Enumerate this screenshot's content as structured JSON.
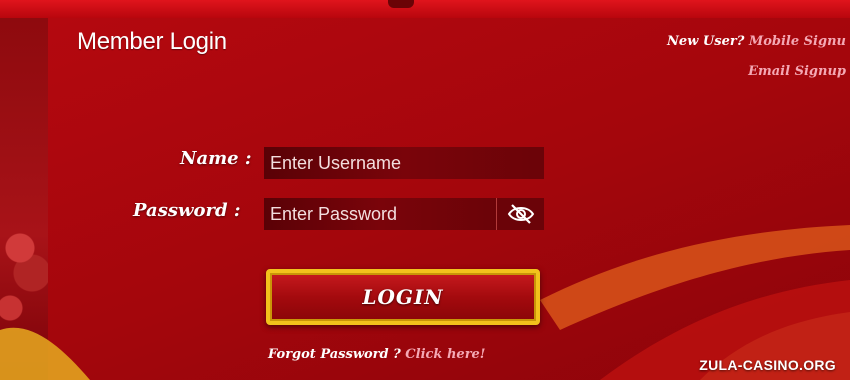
{
  "login": {
    "title": "Member Login",
    "new_user_prefix": "New User?",
    "mobile_signup": "Mobile Signu",
    "email_signup": "Email Signup",
    "name_label": "Name :",
    "name_placeholder": "Enter Username",
    "password_label": "Password :",
    "password_placeholder": "Enter Password",
    "login_button": "LOGIN",
    "forgot_prefix": "Forgot Password ?",
    "forgot_link": "Click here!"
  },
  "watermark": "ZULA-CASINO.ORG",
  "icons": {
    "password_toggle": "eye-slash-icon"
  },
  "colors": {
    "background": "#a4060c",
    "button_border": "#f2c21c",
    "link": "#f4a8b4"
  }
}
